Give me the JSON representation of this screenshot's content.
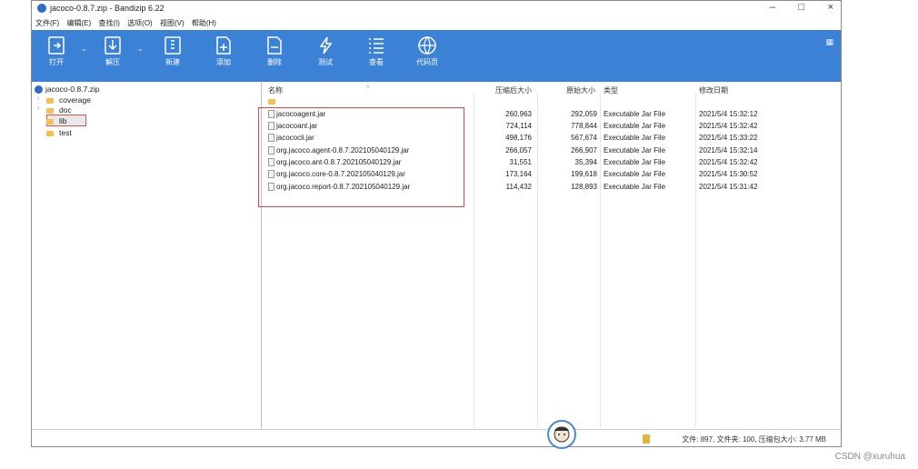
{
  "window": {
    "title": "jacoco-0.8.7.zip - Bandizip 6.22",
    "min": "–",
    "max": "□",
    "close": "×"
  },
  "menu": [
    "文件(F)",
    "编辑(E)",
    "查找(I)",
    "选项(O)",
    "视图(V)",
    "帮助(H)"
  ],
  "toolbar": [
    {
      "label": "打开",
      "icon": "open-icon"
    },
    {
      "label": "解压",
      "icon": "extract-icon"
    },
    {
      "label": "新建",
      "icon": "new-archive-icon"
    },
    {
      "label": "添加",
      "icon": "add-icon"
    },
    {
      "label": "删除",
      "icon": "delete-icon"
    },
    {
      "label": "测试",
      "icon": "test-icon"
    },
    {
      "label": "查看",
      "icon": "view-icon"
    },
    {
      "label": "代码页",
      "icon": "codepage-icon"
    }
  ],
  "tree": {
    "root": "jacoco-0.8.7.zip",
    "items": [
      "coverage",
      "doc",
      "lib",
      "test"
    ],
    "selected": "lib"
  },
  "columns": [
    "名称",
    "压缩后大小",
    "原始大小",
    "类型",
    "修改日期"
  ],
  "files": [
    {
      "name": "jacocoagent.jar",
      "packed": "260,963",
      "size": "292,059",
      "type": "Executable Jar File",
      "date": "2021/5/4 15:32:12"
    },
    {
      "name": "jacocoant.jar",
      "packed": "724,114",
      "size": "778,844",
      "type": "Executable Jar File",
      "date": "2021/5/4 15:32:42"
    },
    {
      "name": "jacococli.jar",
      "packed": "498,176",
      "size": "567,674",
      "type": "Executable Jar File",
      "date": "2021/5/4 15:33:22"
    },
    {
      "name": "org.jacoco.agent-0.8.7.202105040129.jar",
      "packed": "266,057",
      "size": "266,907",
      "type": "Executable Jar File",
      "date": "2021/5/4 15:32:14"
    },
    {
      "name": "org.jacoco.ant-0.8.7.202105040129.jar",
      "packed": "31,551",
      "size": "35,394",
      "type": "Executable Jar File",
      "date": "2021/5/4 15:32:42"
    },
    {
      "name": "org.jacoco.core-0.8.7.202105040129.jar",
      "packed": "173,164",
      "size": "199,618",
      "type": "Executable Jar File",
      "date": "2021/5/4 15:30:52"
    },
    {
      "name": "org.jacoco.report-0.8.7.202105040129.jar",
      "packed": "114,432",
      "size": "128,893",
      "type": "Executable Jar File",
      "date": "2021/5/4 15:31:42"
    }
  ],
  "status": "文件: 897, 文件夹: 100, 压缩包大小: 3.77 MB",
  "watermark": "CSDN @xuruhua",
  "colors": {
    "toolbar": "#3b82d6",
    "highlight": "#d24b4b"
  }
}
